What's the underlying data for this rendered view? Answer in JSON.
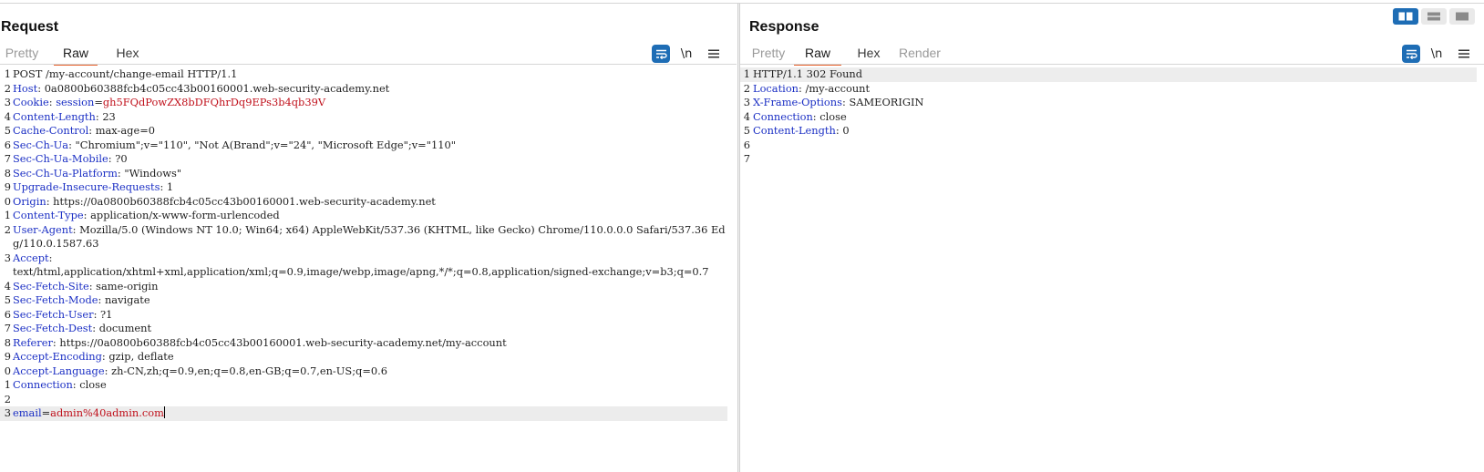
{
  "request": {
    "title": "Request",
    "tabs": [
      {
        "label": "Pretty",
        "state": "dim"
      },
      {
        "label": "Raw",
        "state": "active"
      },
      {
        "label": "Hex",
        "state": "normal"
      }
    ],
    "tools": {
      "newline_label": "\\n",
      "wrap_icon": "wrap-lines-icon",
      "menu_icon": "hamburger-menu-icon"
    },
    "lines": [
      {
        "num": "1",
        "plain": "POST /my-account/change-email HTTP/1.1"
      },
      {
        "num": "2",
        "key": "Host",
        "sep": ": ",
        "value": "0a0800b60388fcb4c05cc43b00160001.web-security-academy.net"
      },
      {
        "num": "3",
        "key": "Cookie",
        "sep": ": ",
        "value": "",
        "cookie_name": "session",
        "cookie_eq": "=",
        "cookie_value": "gh5FQdPowZX8bDFQhrDq9EPs3b4qb39V"
      },
      {
        "num": "4",
        "key": "Content-Length",
        "sep": ": ",
        "value": "23"
      },
      {
        "num": "5",
        "key": "Cache-Control",
        "sep": ": ",
        "value": "max-age=0"
      },
      {
        "num": "6",
        "key": "Sec-Ch-Ua",
        "sep": ": ",
        "value": "\"Chromium\";v=\"110\", \"Not A(Brand\";v=\"24\", \"Microsoft Edge\";v=\"110\""
      },
      {
        "num": "7",
        "key": "Sec-Ch-Ua-Mobile",
        "sep": ": ",
        "value": "?0"
      },
      {
        "num": "8",
        "key": "Sec-Ch-Ua-Platform",
        "sep": ": ",
        "value": "\"Windows\""
      },
      {
        "num": "9",
        "key": "Upgrade-Insecure-Requests",
        "sep": ": ",
        "value": "1"
      },
      {
        "num": "0",
        "key": "Origin",
        "sep": ": ",
        "value": "https://0a0800b60388fcb4c05cc43b00160001.web-security-academy.net"
      },
      {
        "num": "1",
        "key": "Content-Type",
        "sep": ": ",
        "value": "application/x-www-form-urlencoded"
      },
      {
        "num": "2",
        "key": "User-Agent",
        "sep": ": ",
        "value": "Mozilla/5.0 (Windows NT 10.0; Win64; x64) AppleWebKit/537.36 (KHTML, like Gecko) Chrome/110.0.0.0 Safari/537.36 Edg/110.0.1587.63"
      },
      {
        "num": "3",
        "key": "Accept",
        "sep": ":",
        "value": "text/html,application/xhtml+xml,application/xml;q=0.9,image/webp,image/apng,*/*;q=0.8,application/signed-exchange;v=b3;q=0.7",
        "break_before_value": true
      },
      {
        "num": "4",
        "key": "Sec-Fetch-Site",
        "sep": ": ",
        "value": "same-origin"
      },
      {
        "num": "5",
        "key": "Sec-Fetch-Mode",
        "sep": ": ",
        "value": "navigate"
      },
      {
        "num": "6",
        "key": "Sec-Fetch-User",
        "sep": ": ",
        "value": "?1"
      },
      {
        "num": "7",
        "key": "Sec-Fetch-Dest",
        "sep": ": ",
        "value": "document"
      },
      {
        "num": "8",
        "key": "Referer",
        "sep": ": ",
        "value": "https://0a0800b60388fcb4c05cc43b00160001.web-security-academy.net/my-account"
      },
      {
        "num": "9",
        "key": "Accept-Encoding",
        "sep": ": ",
        "value": "gzip, deflate"
      },
      {
        "num": "0",
        "key": "Accept-Language",
        "sep": ": ",
        "value": "zh-CN,zh;q=0.9,en;q=0.8,en-GB;q=0.7,en-US;q=0.6"
      },
      {
        "num": "1",
        "key": "Connection",
        "sep": ": ",
        "value": "close"
      },
      {
        "num": "2",
        "plain": ""
      },
      {
        "num": "3",
        "param_name": "email",
        "param_eq": "=",
        "param_value": "admin%40admin.com",
        "current": true
      }
    ]
  },
  "response": {
    "title": "Response",
    "tabs": [
      {
        "label": "Pretty",
        "state": "dim"
      },
      {
        "label": "Raw",
        "state": "active"
      },
      {
        "label": "Hex",
        "state": "normal"
      },
      {
        "label": "Render",
        "state": "dim"
      }
    ],
    "tools": {
      "newline_label": "\\n",
      "wrap_icon": "wrap-lines-icon",
      "menu_icon": "hamburger-menu-icon"
    },
    "lines": [
      {
        "num": "1",
        "plain": "HTTP/1.1 302 Found"
      },
      {
        "num": "2",
        "key": "Location",
        "sep": ": ",
        "value": "/my-account"
      },
      {
        "num": "3",
        "key": "X-Frame-Options",
        "sep": ": ",
        "value": "SAMEORIGIN"
      },
      {
        "num": "4",
        "key": "Connection",
        "sep": ": ",
        "value": "close"
      },
      {
        "num": "5",
        "key": "Content-Length",
        "sep": ": ",
        "value": "0"
      },
      {
        "num": "6",
        "plain": ""
      },
      {
        "num": "7",
        "plain": ""
      }
    ]
  },
  "layout_toggles": [
    {
      "name": "side-by-side-layout-icon",
      "active": true
    },
    {
      "name": "stacked-layout-icon",
      "active": false
    },
    {
      "name": "single-pane-layout-icon",
      "active": false
    }
  ],
  "colors": {
    "accent": "#1e6db5",
    "tab_underline": "#e8622c",
    "header_key": "#1b2fc4",
    "highlight_value": "#c0101b"
  }
}
